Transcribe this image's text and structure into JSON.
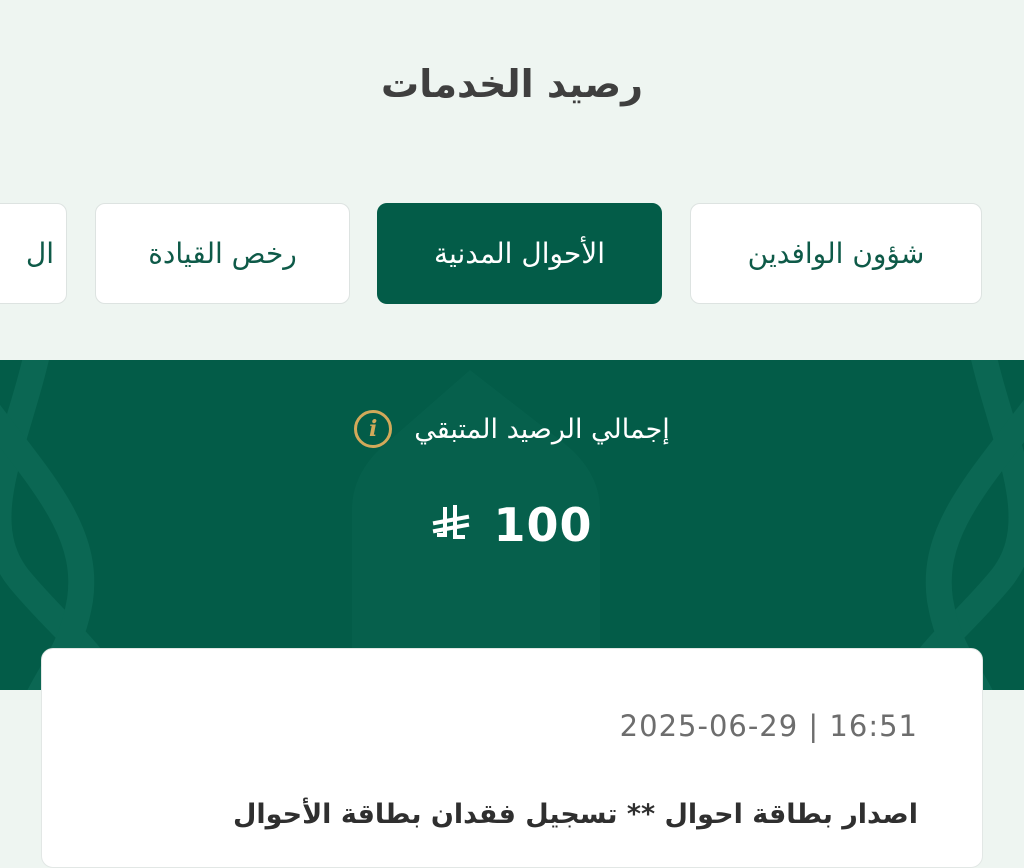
{
  "header": {
    "title": "رصيد الخدمات"
  },
  "tabs": [
    {
      "label": "شؤون الوافدين",
      "active": false
    },
    {
      "label": "الأحوال المدنية",
      "active": true
    },
    {
      "label": "رخص القيادة",
      "active": false
    },
    {
      "label": "ال",
      "active": false
    }
  ],
  "balance": {
    "label": "إجمالي الرصيد المتبقي",
    "amount": "100",
    "currency_icon": "saudi-riyal-icon",
    "info_icon": "info-icon"
  },
  "transaction": {
    "datetime": "2025-06-29 | 16:51",
    "description": "اصدار بطاقة احوال ** تسجيل فقدان بطاقة الأحوال"
  },
  "colors": {
    "primary": "#035c48",
    "accent": "#d2a95a",
    "background": "#eef5f1"
  }
}
